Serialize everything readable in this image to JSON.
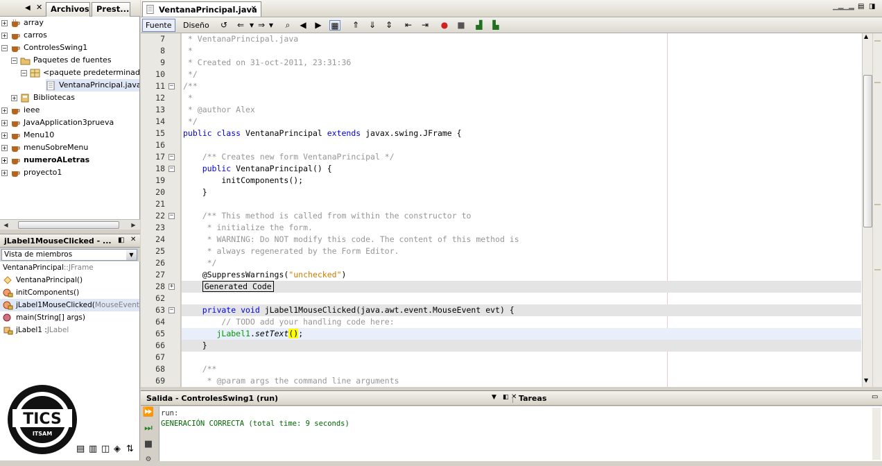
{
  "left": {
    "tabs": [
      "Archivos",
      "Prest..."
    ],
    "projects": [
      {
        "label": "array",
        "bold": false
      },
      {
        "label": "carros",
        "bold": false
      },
      {
        "label": "ControlesSwing1",
        "bold": false
      },
      {
        "label": "Paquetes de fuentes",
        "bold": false
      },
      {
        "label": "<paquete predeterminado",
        "bold": false
      },
      {
        "label": "VentanaPrincipal.java",
        "bold": false
      },
      {
        "label": "Bibliotecas",
        "bold": false
      },
      {
        "label": "ieee",
        "bold": false
      },
      {
        "label": "JavaApplication3prueva",
        "bold": false
      },
      {
        "label": "Menu10",
        "bold": false
      },
      {
        "label": "menuSobreMenu",
        "bold": false
      },
      {
        "label": "numeroALetras",
        "bold": true
      },
      {
        "label": "proyecto1",
        "bold": false
      }
    ],
    "navigator": {
      "title": "jLabel1MouseClicked - ...",
      "view": "Vista de miembros",
      "class_name": "VentanaPrincipal",
      "class_sep": " :: ",
      "class_super": "JFrame",
      "members": [
        {
          "name": "VentanaPrincipal()",
          "type": ""
        },
        {
          "name": "initComponents()",
          "type": ""
        },
        {
          "name": "jLabel1MouseClicked(",
          "type": "MouseEvent ev"
        },
        {
          "name": "main(String[] args)",
          "type": ""
        },
        {
          "name": "jLabel1 : ",
          "type": "JLabel"
        }
      ]
    },
    "logo": {
      "text1": "TICS",
      "text2": "ITSAM"
    }
  },
  "editor": {
    "tab_label": "VentanaPrincipal.java",
    "view_buttons": [
      "Fuente",
      "Diseño"
    ],
    "line_numbers": [
      "7",
      "8",
      "9",
      "10",
      "11",
      "12",
      "13",
      "14",
      "15",
      "16",
      "17",
      "18",
      "19",
      "20",
      "21",
      "22",
      "23",
      "24",
      "25",
      "26",
      "27",
      "28",
      "62",
      "63",
      "64",
      "65",
      "66",
      "67",
      "68",
      "69"
    ],
    "lines": [
      [
        {
          "t": " * VentanaPrincipal.java",
          "c": "cm"
        }
      ],
      [
        {
          "t": " *",
          "c": "cm"
        }
      ],
      [
        {
          "t": " * Created on 31-oct-2011, 23:31:36",
          "c": "cm"
        }
      ],
      [
        {
          "t": " */",
          "c": "cm"
        }
      ],
      [
        {
          "t": "/**",
          "c": "cm"
        }
      ],
      [
        {
          "t": " *",
          "c": "cm"
        }
      ],
      [
        {
          "t": " * @author Alex",
          "c": "cm"
        }
      ],
      [
        {
          "t": " */",
          "c": "cm"
        }
      ],
      [
        {
          "t": "public class ",
          "c": "k"
        },
        {
          "t": "VentanaPrincipal",
          "c": "id"
        },
        {
          "t": " extends ",
          "c": "k"
        },
        {
          "t": "javax.swing.JFrame {",
          "c": "id"
        }
      ],
      [
        {
          "t": "",
          "c": "id"
        }
      ],
      [
        {
          "t": "    /** Creates new form VentanaPrincipal */",
          "c": "cm"
        }
      ],
      [
        {
          "t": "    public ",
          "c": "k"
        },
        {
          "t": "VentanaPrincipal() {",
          "c": "id"
        }
      ],
      [
        {
          "t": "        initComponents();",
          "c": "id"
        }
      ],
      [
        {
          "t": "    }",
          "c": "id"
        }
      ],
      [
        {
          "t": "",
          "c": "id"
        }
      ],
      [
        {
          "t": "    /** This method is called from within the constructor to",
          "c": "cm"
        }
      ],
      [
        {
          "t": "     * initialize the form.",
          "c": "cm"
        }
      ],
      [
        {
          "t": "     * WARNING: Do NOT modify this code. The content of this method is",
          "c": "cm"
        }
      ],
      [
        {
          "t": "     * always regenerated by the Form Editor.",
          "c": "cm"
        }
      ],
      [
        {
          "t": "     */",
          "c": "cm"
        }
      ],
      [
        {
          "t": "    @SuppressWarnings(",
          "c": "id"
        },
        {
          "t": "\"unchecked\"",
          "c": "s"
        },
        {
          "t": ")",
          "c": "id"
        }
      ],
      [
        {
          "t": "    ",
          "c": "id"
        },
        {
          "t": "Generated Code",
          "c": "boxed"
        }
      ],
      [
        {
          "t": "",
          "c": "id"
        }
      ],
      [
        {
          "t": "    private void ",
          "c": "k"
        },
        {
          "t": "jLabel1MouseClicked(java.awt.event.MouseEvent evt) {",
          "c": "id"
        }
      ],
      [
        {
          "t": "        // TODO add your handling code here:",
          "c": "cm"
        }
      ],
      [
        {
          "t": "       ",
          "c": "id"
        },
        {
          "t": "jLabel1",
          "c": "fld"
        },
        {
          "t": ".",
          "c": "id"
        },
        {
          "t": "setText",
          "c": "it"
        },
        {
          "t": "()",
          "c": "paren"
        },
        {
          "t": ";",
          "c": "id"
        }
      ],
      [
        {
          "t": "    }",
          "c": "id"
        }
      ],
      [
        {
          "t": "",
          "c": "id"
        }
      ],
      [
        {
          "t": "    /**",
          "c": "cm"
        }
      ],
      [
        {
          "t": "     * @param args the command line arguments",
          "c": "cm"
        }
      ]
    ],
    "folds": {
      "11": "−",
      "17": "−",
      "18": "−",
      "22": "−",
      "28": "+",
      "63": "−"
    }
  },
  "output": {
    "title": "Salida - ControlesSwing1 (run)",
    "tasks_tab": "Tareas",
    "lines": [
      "run:",
      "GENERACIÓN CORRECTA (total time: 9 seconds)"
    ]
  },
  "colors": {
    "keyword": "#0000e6",
    "comment": "#969696",
    "string": "#ce7b00",
    "field": "#009900",
    "success": "#006600"
  }
}
